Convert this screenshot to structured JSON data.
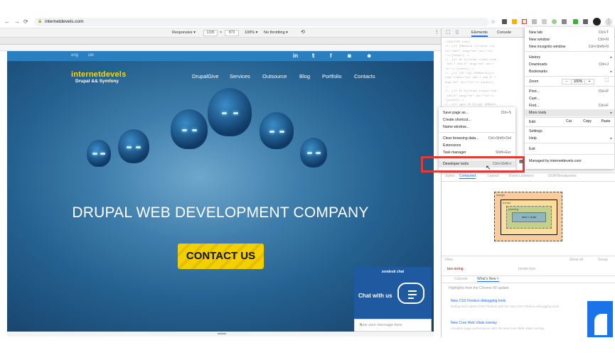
{
  "browser": {
    "url": "internetdevels.com",
    "back_icon": "←",
    "forward_icon": "→",
    "reload_icon": "⟳",
    "lock_icon": "🔒",
    "star_icon": "☆",
    "menu_icon": "⋮"
  },
  "device_toolbar": {
    "mode": "Responsive ▾",
    "width": "1335",
    "times": "×",
    "height": "873",
    "zoom": "100% ▾",
    "throttle": "No throttling ▾",
    "rotate_icon": "⟲",
    "more_icon": "⋮"
  },
  "site": {
    "lang_eng": "eng",
    "lang_ukr": "ukr",
    "social": [
      "in",
      "𝕥",
      "f",
      "◙",
      "☻"
    ],
    "logo_title": "internetdevels",
    "logo_subtitle": "Drupal && Symfony",
    "nav": [
      "DrupalGive",
      "Services",
      "Outsource",
      "Blog",
      "Portfolio",
      "Contacts"
    ],
    "headline": "DRUPAL WEB DEVELOPMENT COMPANY",
    "cta": "CONTACT US",
    "chat_brand": "zendesk chat",
    "chat_with_us": "Chat with us",
    "chat_placeholder": "Type your message here",
    "send_icon": "➤"
  },
  "devtools": {
    "tab_elements": "Elements",
    "tab_console": "Console",
    "inspect_icon": "⬚",
    "device_icon": "▯",
    "code_lines": [
      "<!DOCTYPE html>",
      "<!--[if IEMobile 7]><html cla",
      "ss=\"iem7\" lang=\"en\" dir=\"ltr",
      "\"><![endif]-->",
      "<!--[if IE 6]><html class=\"ie6",
      " ie6-7 ie6-8\" lang=\"en\" dir=\"",
      "ltr\"><![endif]-->",
      "<!--[if (IE 7)&(!IEMobile)]><",
      "html class=\"ie7 ie6-7 ie6-8\" l",
      "ang=\"en\" dir=\"ltr\"><![endif]-",
      "->",
      "<!--[if IE 8]><html class=\"ie8",
      " ie6-8\" lang=\"en\" dir=\"ltr\"><",
      "![endif]-->",
      "<!--[if (gte IE 9)|(gt IEMobil",
      "e 7)]><!--><html lang=\"en\" d",
      "ir=\"ltr\"><!--<![endif]-->"
    ],
    "panes": [
      "Styles",
      "Computed",
      "Layout",
      "Event Listeners",
      "DOM Breakpoints"
    ],
    "box_margin": "margin",
    "box_border": "border",
    "box_padding": "padding",
    "box_content": "auto × auto",
    "filter": "Filter",
    "show_all": "Show all",
    "group": "Group",
    "prop_left": "box-sizing",
    "prop_right": "border-box",
    "drawer_console": "Console",
    "drawer_whatsnew": "What's New ×",
    "highlights": "Highlights from the Chrome 90 update",
    "news1_title": "New CSS Flexbox debugging tools",
    "news1_sub": "Debug and inspect CSS Flexbox with the new CSS Flexbox debugging tools.",
    "news2_title": "New Core Web Vitals overlay",
    "news2_sub": "Visualize page performance with the new Core Web Vitals overlay."
  },
  "chrome_menu": {
    "items": [
      {
        "label": "New tab",
        "shortcut": "Ctrl+T"
      },
      {
        "label": "New window",
        "shortcut": "Ctrl+N"
      },
      {
        "label": "New incognito window",
        "shortcut": "Ctrl+Shift+N"
      },
      {
        "label": "History",
        "shortcut": "▸"
      },
      {
        "label": "Downloads",
        "shortcut": "Ctrl+J"
      },
      {
        "label": "Bookmarks",
        "shortcut": "▸"
      }
    ],
    "zoom_label": "Zoom",
    "zoom_minus": "−",
    "zoom_value": "100%",
    "zoom_plus": "+",
    "fullscreen_icon": "⛶",
    "print": "Print...",
    "print_sc": "Ctrl+P",
    "cast": "Cast...",
    "find": "Find...",
    "find_sc": "Ctrl+F",
    "more_tools": "More tools",
    "edit": "Edit",
    "cut": "Cut",
    "copy": "Copy",
    "paste": "Paste",
    "settings": "Settings",
    "help": "Help",
    "exit": "Exit",
    "managed": "Managed by internetdevels.com",
    "managed_icon": "▦"
  },
  "more_tools_menu": [
    {
      "label": "Save page as...",
      "shortcut": "Ctrl+S"
    },
    {
      "label": "Create shortcut...",
      "shortcut": ""
    },
    {
      "label": "Name window...",
      "shortcut": ""
    },
    {
      "label": "Clear browsing data...",
      "shortcut": "Ctrl+Shift+Del"
    },
    {
      "label": "Extensions",
      "shortcut": ""
    },
    {
      "label": "Task manager",
      "shortcut": "Shift+Esc"
    },
    {
      "label": "Developer tools",
      "shortcut": "Ctrl+Shift+I"
    }
  ],
  "colors": {
    "highlight_border": "#e53935",
    "logo_yellow": "#ffd500",
    "cta_yellow": "#f5d000",
    "chat_blue": "#1f5aa0"
  }
}
